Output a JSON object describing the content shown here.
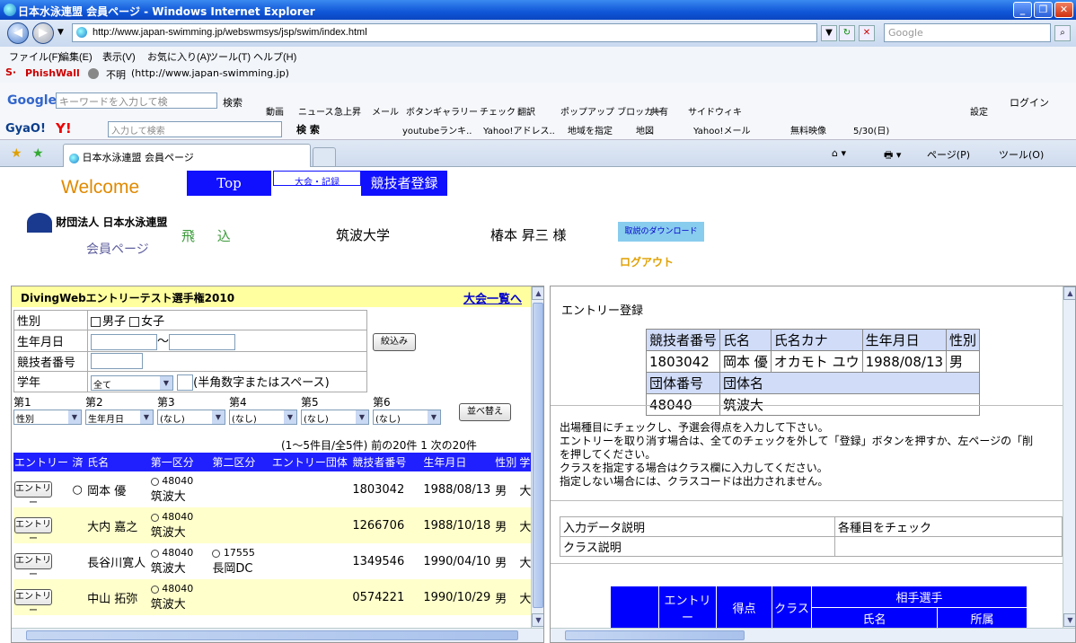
{
  "window": {
    "title": "日本水泳連盟 会員ページ - Windows Internet Explorer"
  },
  "addressbar": {
    "url": "http://www.japan-swimming.jp/webswmsys/jsp/swim/index.html",
    "search_placeholder": "Google"
  },
  "menu": [
    "ファイル(F)",
    "編集(E)",
    "表示(V)",
    "お気に入り(A)",
    "ツール(T)",
    "ヘルプ(H)"
  ],
  "phishwall": {
    "label": "PhishWall",
    "status": "不明",
    "url": "(http://www.japan-swimming.jp)"
  },
  "google_toolbar": {
    "search_placeholder": "キーワードを入力して検",
    "search_btn": "検索",
    "items": [
      "動画",
      "ニュース",
      "急上昇",
      "メール",
      "ボタンギャラリー",
      "チェック",
      "翻訳",
      "ポップアップ ブロッカー",
      "共有",
      "サイドウィキ",
      "設定",
      "ログイン"
    ]
  },
  "gyao_toolbar": {
    "label": "GyaO!",
    "search_placeholder": "入力して検索",
    "search_btn": "検 索",
    "items": [
      "youtubeランキ..",
      "Yahoo!アドレス..",
      "地域を指定",
      "地図",
      "Yahoo!メール",
      "無料映像",
      "5/30(日)"
    ]
  },
  "tab": {
    "title": "日本水泳連盟 会員ページ"
  },
  "cmdbar": {
    "page": "ページ(P)",
    "tools": "ツール(O)"
  },
  "header": {
    "welcome": "Welcome",
    "nav": [
      "Top",
      "大会・記録",
      "競技者登録"
    ],
    "org": "財団法人 日本水泳連盟",
    "member_page": "会員ページ",
    "discipline": "飛 込",
    "university": "筑波大学",
    "user": "椿本 昇三 様",
    "download": "取説のダウンロード",
    "logout": "ログアウト"
  },
  "left": {
    "competition": "DivingWebエントリーテスト選手権2010",
    "back_link": "大会一覧へ",
    "filter": {
      "sex_label": "性別",
      "male": "男子",
      "female": "女子",
      "dob_label": "生年月日",
      "tilde": "〜",
      "id_label": "競技者番号",
      "grade_label": "学年",
      "grade_value": "全て",
      "grade_note": "(半角数字またはスペース)",
      "filter_btn": "絞込み"
    },
    "sort": {
      "labels": [
        "第1",
        "第2",
        "第3",
        "第4",
        "第5",
        "第6"
      ],
      "values": [
        "性別",
        "生年月日",
        "(なし)",
        "(なし)",
        "(なし)",
        "(なし)"
      ],
      "btn": "並べ替え"
    },
    "paging": "(1〜5件目/全5件) 前の20件 1 次の20件",
    "columns": [
      "エントリー",
      "済",
      "氏名",
      "第一区分",
      "第二区分",
      "エントリー団体",
      "競技者番号",
      "生年月日",
      "性別",
      "学"
    ],
    "rows": [
      {
        "btn": "エントリー",
        "done": "○",
        "name": "岡本 優",
        "div1_code": "48040",
        "div1_name": "筑波大",
        "div2_code": "",
        "div2_name": "",
        "id": "1803042",
        "dob": "1988/08/13",
        "sex": "男",
        "grade": "大"
      },
      {
        "btn": "エントリー",
        "done": "",
        "name": "大内 嘉之",
        "div1_code": "48040",
        "div1_name": "筑波大",
        "div2_code": "",
        "div2_name": "",
        "id": "1266706",
        "dob": "1988/10/18",
        "sex": "男",
        "grade": "大"
      },
      {
        "btn": "エントリー",
        "done": "",
        "name": "長谷川寛人",
        "div1_code": "48040",
        "div1_name": "筑波大",
        "div2_code": "17555",
        "div2_name": "長岡DC",
        "id": "1349546",
        "dob": "1990/04/10",
        "sex": "男",
        "grade": "大"
      },
      {
        "btn": "エントリー",
        "done": "",
        "name": "中山 拓弥",
        "div1_code": "48040",
        "div1_name": "筑波大",
        "div2_code": "",
        "div2_name": "",
        "id": "0574221",
        "dob": "1990/10/29",
        "sex": "男",
        "grade": "大"
      }
    ]
  },
  "right": {
    "title": "エントリー登録",
    "athlete_headers": [
      "競技者番号",
      "氏名",
      "氏名カナ",
      "生年月日",
      "性別"
    ],
    "athlete": [
      "1803042",
      "岡本 優",
      "オカモト ユウ",
      "1988/08/13",
      "男"
    ],
    "team_headers": [
      "団体番号",
      "団体名"
    ],
    "team": [
      "48040",
      "筑波大"
    ],
    "instructions": [
      "出場種目にチェックし、予選会得点を入力して下さい。",
      "エントリーを取り消す場合は、全てのチェックを外して「登録」ボタンを押すか、左ページの「削",
      "を押してください。",
      "クラスを指定する場合はクラス欄に入力してください。",
      "指定しない場合には、クラスコードは出力されません。"
    ],
    "info": [
      [
        "入力データ説明",
        "各種目をチェック"
      ],
      [
        "クラス説明",
        ""
      ]
    ],
    "event_headers": [
      "エントリー",
      "得点",
      "クラス",
      "相手選手",
      "氏名",
      "所属"
    ]
  }
}
